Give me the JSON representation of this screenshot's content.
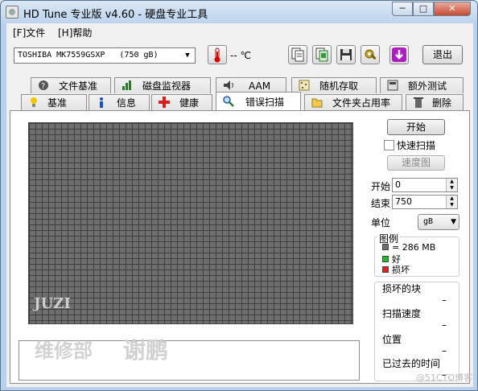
{
  "window": {
    "title": "HD Tune 专业版 v4.60 - 硬盘专业工具",
    "min": "─",
    "max": "□",
    "close": "✕"
  },
  "menu": [
    {
      "label": "[F]文件"
    },
    {
      "label": "[H]帮助"
    }
  ],
  "toolbar": {
    "drive": "TOSHIBA MK7559GSXP   (750 gB)",
    "temperature": "-- ℃",
    "exit_label": "退出",
    "icons": [
      "thermometer-icon",
      "copy-text-icon",
      "copy-screenshot-icon",
      "save-icon",
      "settings-icon",
      "download-icon"
    ]
  },
  "tabs_top": [
    {
      "label": "文件基准",
      "icon": "file-benchmark-icon"
    },
    {
      "label": "磁盘监视器",
      "icon": "disk-monitor-icon"
    },
    {
      "label": "AAM",
      "icon": "speaker-icon"
    },
    {
      "label": "随机存取",
      "icon": "random-access-icon"
    },
    {
      "label": "额外测试",
      "icon": "extra-tests-icon"
    }
  ],
  "tabs_bottom": [
    {
      "label": "基准",
      "icon": "benchmark-icon"
    },
    {
      "label": "信息",
      "icon": "info-icon"
    },
    {
      "label": "健康",
      "icon": "health-icon"
    },
    {
      "label": "错误扫描",
      "icon": "magnifier-icon",
      "active": true
    },
    {
      "label": "文件夹占用率",
      "icon": "folder-icon"
    },
    {
      "label": "删除",
      "icon": "trash-icon"
    }
  ],
  "scan": {
    "start_button": "开始",
    "quick_scan_label": "快速扫描",
    "quick_scan_checked": false,
    "speed_map_button": "速度图",
    "start_label": "开始",
    "start_value": "0",
    "end_label": "结束",
    "end_value": "750",
    "unit_label": "单位",
    "unit_value": "gB",
    "legend_title": "图例",
    "legend": [
      {
        "text": "= 286 MB",
        "color": "#6e6e6e"
      },
      {
        "text": "好",
        "color": "#22bb22"
      },
      {
        "text": "损坏",
        "color": "#dd2222"
      }
    ],
    "stats": [
      {
        "label": "损坏的块",
        "value": "–"
      },
      {
        "label": "扫描速度",
        "value": "–"
      },
      {
        "label": "位置",
        "value": "–"
      },
      {
        "label": "已过去的时间",
        "value": "–"
      }
    ]
  },
  "watermarks": {
    "logo": "JUZI",
    "left": "维修部",
    "right": "谢鹏",
    "corner": "@51CTO博客"
  },
  "colors": {
    "grid_fill": "#6e6e6e",
    "grid_line": "#3e3e3e",
    "window_frame": "#b9d1ea"
  }
}
